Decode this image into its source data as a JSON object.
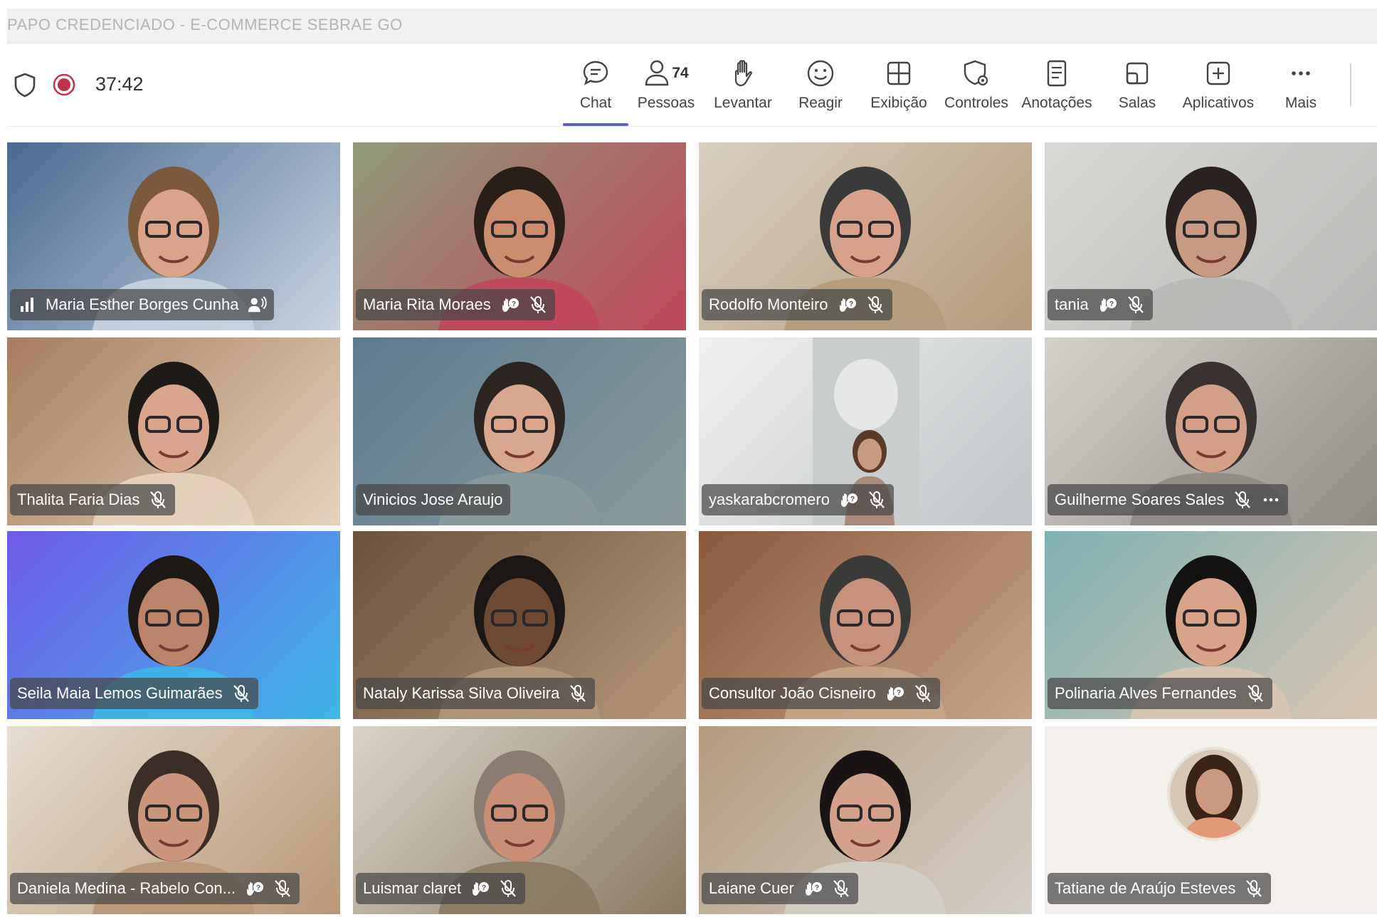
{
  "window": {
    "title": "PAPO CREDENCIADO - E-COMMERCE SEBRAE GO"
  },
  "toolbar": {
    "timer": "37:42",
    "people_count": "74",
    "buttons": [
      {
        "id": "chat",
        "label": "Chat",
        "icon": "chat-icon",
        "active": true
      },
      {
        "id": "people",
        "label": "Pessoas",
        "icon": "people-icon"
      },
      {
        "id": "raise",
        "label": "Levantar",
        "icon": "raise-hand-icon"
      },
      {
        "id": "react",
        "label": "Reagir",
        "icon": "smiley-icon"
      },
      {
        "id": "view",
        "label": "Exibição",
        "icon": "grid-view-icon"
      },
      {
        "id": "controls",
        "label": "Controles",
        "icon": "shield-gear-icon"
      },
      {
        "id": "notes",
        "label": "Anotações",
        "icon": "notes-icon"
      },
      {
        "id": "rooms",
        "label": "Salas",
        "icon": "rooms-icon"
      },
      {
        "id": "apps",
        "label": "Aplicativos",
        "icon": "add-app-icon"
      },
      {
        "id": "more",
        "label": "Mais",
        "icon": "more-icon"
      }
    ]
  },
  "participants": [
    {
      "name": "Maria Esther Borges Cunha",
      "bg": "#4a6a8f",
      "bg2": "#c9d4e2",
      "skin": "#d9a588",
      "hair": "#7a5a3a",
      "icons": [
        "signal-icon",
        "speaking-icon"
      ]
    },
    {
      "name": "Maria Rita Moraes",
      "bg": "#8e9a7a",
      "bg2": "#c0475a",
      "skin": "#c98e6e",
      "hair": "#2a1e18",
      "icons": [
        "hand-help-icon",
        "mic-off-icon"
      ]
    },
    {
      "name": "Rodolfo Monteiro",
      "bg": "#d8cfc2",
      "bg2": "#b59b7a",
      "skin": "#d6a38a",
      "hair": "#3a3a3a",
      "icons": [
        "hand-help-icon",
        "mic-off-icon"
      ]
    },
    {
      "name": "tania",
      "bg": "#d9d9d6",
      "bg2": "#b7b8b5",
      "skin": "#c79a84",
      "hair": "#2a2220",
      "icons": [
        "hand-help-icon",
        "mic-off-icon"
      ]
    },
    {
      "name": "Thalita Faria Dias",
      "bg": "#a57e5c",
      "bg2": "#e5d3bf",
      "skin": "#d8a68c",
      "hair": "#1e1a18",
      "icons": [
        "mic-off-icon"
      ]
    },
    {
      "name": "Vinicios Jose Araujo",
      "bg": "#5e7b8f",
      "bg2": "#8a9a9c",
      "skin": "#d8a88e",
      "hair": "#2c2420",
      "icons": []
    },
    {
      "name": "yaskarabcromero",
      "bg": "#f0f0f0",
      "bg2": "#bfc4c6",
      "skin": "#c99a82",
      "hair": "#5a3a28",
      "icons": [
        "hand-help-icon",
        "mic-off-icon"
      ]
    },
    {
      "name": "Guilherme Soares Sales",
      "bg": "#d6d1cb",
      "bg2": "#8f8a84",
      "skin": "#d2a088",
      "hair": "#3a3230",
      "icons": [
        "mic-off-icon",
        "ellipsis-icon"
      ]
    },
    {
      "name": "Seila Maia Lemos Guimarães",
      "bg": "#6f5ae8",
      "bg2": "#3fb6e8",
      "skin": "#b98468",
      "hair": "#1f1916",
      "icons": [
        "mic-off-icon"
      ]
    },
    {
      "name": "Nataly Karissa Silva Oliveira",
      "bg": "#6b523c",
      "bg2": "#b4977a",
      "skin": "#6e4a34",
      "hair": "#1c1614",
      "icons": [
        "mic-off-icon"
      ]
    },
    {
      "name": "Consultor João Cisneiro",
      "bg": "#8a5a3c",
      "bg2": "#c7a58a",
      "skin": "#c4917a",
      "hair": "#3a3a38",
      "icons": [
        "hand-help-icon",
        "mic-off-icon"
      ]
    },
    {
      "name": "Polinaria Alves Fernandes",
      "bg": "#7fb1b3",
      "bg2": "#d9c4b1",
      "skin": "#d7a48a",
      "hair": "#151212",
      "icons": [
        "mic-off-icon"
      ]
    },
    {
      "name": "Daniela Medina - Rabelo Con...",
      "bg": "#e6ddd2",
      "bg2": "#b89775",
      "skin": "#c9967c",
      "hair": "#3a2e26",
      "icons": [
        "hand-help-icon",
        "mic-off-icon"
      ]
    },
    {
      "name": "Luismar claret",
      "bg": "#d9d3c9",
      "bg2": "#8a7a62",
      "skin": "#c88f74",
      "hair": "#8a7c70",
      "icons": [
        "hand-help-icon",
        "mic-off-icon"
      ]
    },
    {
      "name": "Laiane Cuer",
      "bg": "#b49b7e",
      "bg2": "#d4cfc8",
      "skin": "#d2a28c",
      "hair": "#1a1414",
      "icons": [
        "hand-help-icon",
        "mic-off-icon"
      ]
    },
    {
      "name": "Tatiane de Araújo Esteves",
      "bg": "#f3efea",
      "bg2": "#f3efea",
      "skin": "#c99a80",
      "hair": "#3a2418",
      "icons": [
        "mic-off-icon"
      ],
      "avatar": true
    }
  ]
}
